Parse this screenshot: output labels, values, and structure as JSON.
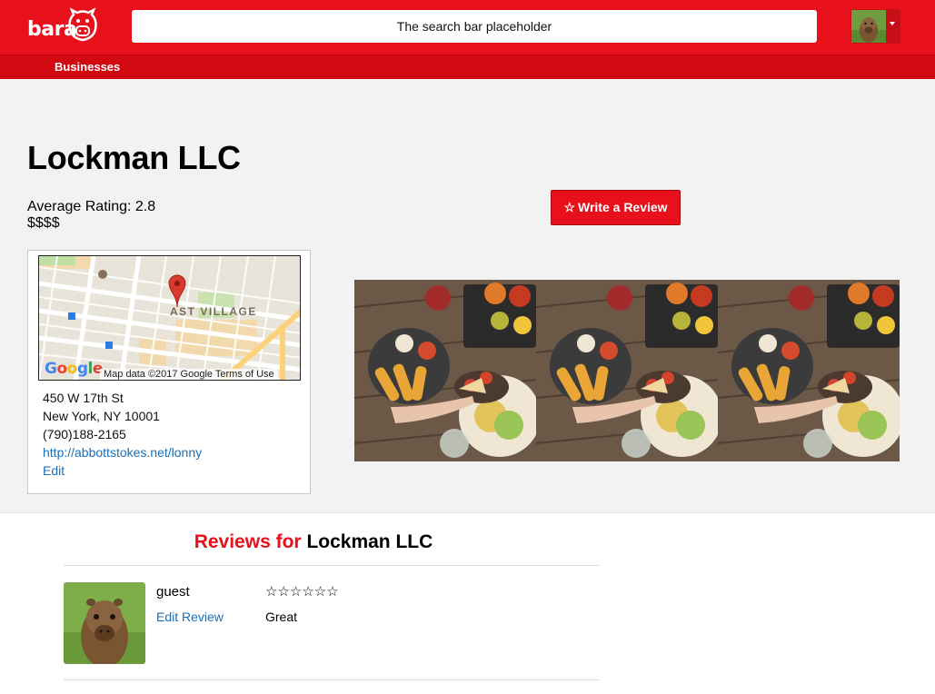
{
  "header": {
    "logo_text": "bara",
    "search_placeholder": "The search bar placeholder",
    "nav_link": "Businesses"
  },
  "business": {
    "name": "Lockman LLC",
    "average_rating_label": "Average Rating: 2.8",
    "price": "$$$$",
    "write_review_label": "Write a Review",
    "write_review_icon": "☆",
    "map": {
      "neighborhood_label": "AST VILLAGE",
      "google_label": "Google",
      "credit": "Map data ©2017 Google   Terms of Use"
    },
    "address_line1": "450 W 17th St",
    "address_line2": "New York, NY 10001",
    "phone": "(790)188-2165",
    "website": "http://abbottstokes.net/lonny",
    "edit_label": "Edit"
  },
  "reviews": {
    "title_prefix": "Reviews for",
    "title_name": "Lockman LLC",
    "items": [
      {
        "user": "guest",
        "edit_label": "Edit Review",
        "stars": "☆☆☆☆☆☆",
        "body": "Great"
      }
    ]
  },
  "colors": {
    "brand_red": "#e8101a",
    "link_blue": "#1a6fb5"
  }
}
